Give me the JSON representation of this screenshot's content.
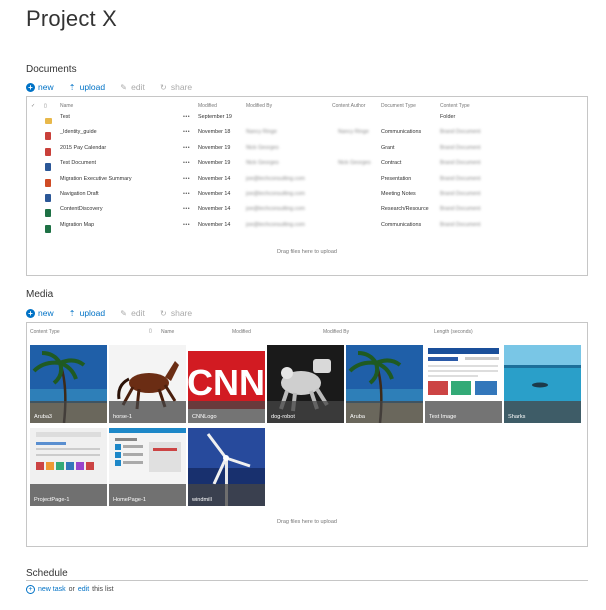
{
  "page_title": "Project X",
  "documents": {
    "title": "Documents",
    "toolbar": {
      "new": "new",
      "upload": "upload",
      "edit": "edit",
      "share": "share"
    },
    "columns": [
      "Name",
      "Modified",
      "Modified By",
      "Content Author",
      "Document Type",
      "Content Type"
    ],
    "rows": [
      {
        "icon": "folder",
        "name": "Test",
        "modified": "September 19",
        "modified_by": "",
        "author": "",
        "doc_type": "",
        "content_type": "Folder"
      },
      {
        "icon": "pdf",
        "name": "_Identity_guide",
        "modified": "November 18",
        "modified_by": "Nancy Ringe",
        "author": "Nancy Ringe",
        "doc_type": "Communications",
        "content_type": "Brand Document"
      },
      {
        "icon": "pdf",
        "name": "2015 Pay Calendar",
        "modified": "November 19",
        "modified_by": "Nick Georges",
        "author": "",
        "doc_type": "Grant",
        "content_type": "Brand Document"
      },
      {
        "icon": "word",
        "name": "Test Document",
        "modified": "November 19",
        "modified_by": "Nick Georges",
        "author": "Nick Georges",
        "doc_type": "Contract",
        "content_type": "Brand Document"
      },
      {
        "icon": "ppt",
        "name": "Migration Executive Summary",
        "modified": "November 14",
        "modified_by": "joe@techconsulting.com",
        "author": "",
        "doc_type": "Presentation",
        "content_type": "Brand Document"
      },
      {
        "icon": "word",
        "name": "Navigation Draft",
        "modified": "November 14",
        "modified_by": "joe@techconsulting.com",
        "author": "",
        "doc_type": "Meeting Notes",
        "content_type": "Brand Document"
      },
      {
        "icon": "excel",
        "name": "ContentDiscovery",
        "modified": "November 14",
        "modified_by": "joe@techconsulting.com",
        "author": "",
        "doc_type": "Research/Resource",
        "content_type": "Brand Document"
      },
      {
        "icon": "excel",
        "name": "Migration Map",
        "modified": "November 14",
        "modified_by": "joe@techconsulting.com",
        "author": "",
        "doc_type": "Communications",
        "content_type": "Brand Document"
      }
    ],
    "drag_text": "Drag files here to upload"
  },
  "media": {
    "title": "Media",
    "toolbar": {
      "new": "new",
      "upload": "upload",
      "edit": "edit",
      "share": "share"
    },
    "columns": [
      "Content Type",
      "Name",
      "Modified",
      "Modified By",
      "Length (seconds)"
    ],
    "tiles": [
      {
        "name": "Aruba3",
        "kind": "beach"
      },
      {
        "name": "horse-1",
        "kind": "horse"
      },
      {
        "name": "CNNLogo",
        "kind": "cnn"
      },
      {
        "name": "dog-robot",
        "kind": "robot"
      },
      {
        "name": "Aruba",
        "kind": "beach"
      },
      {
        "name": "Test Image",
        "kind": "web"
      },
      {
        "name": "Sharks",
        "kind": "sea"
      },
      {
        "name": "ProjectPage-1",
        "kind": "page1"
      },
      {
        "name": "HomePage-1",
        "kind": "page2"
      },
      {
        "name": "windmill",
        "kind": "windmill"
      }
    ],
    "drag_text": "Drag files here to upload"
  },
  "schedule": {
    "title": "Schedule",
    "new_task": "new task",
    "or": "or",
    "edit": "edit",
    "this_list": "this list"
  },
  "colors": {
    "accent": "#0072c6",
    "border": "#c6c6c6"
  }
}
